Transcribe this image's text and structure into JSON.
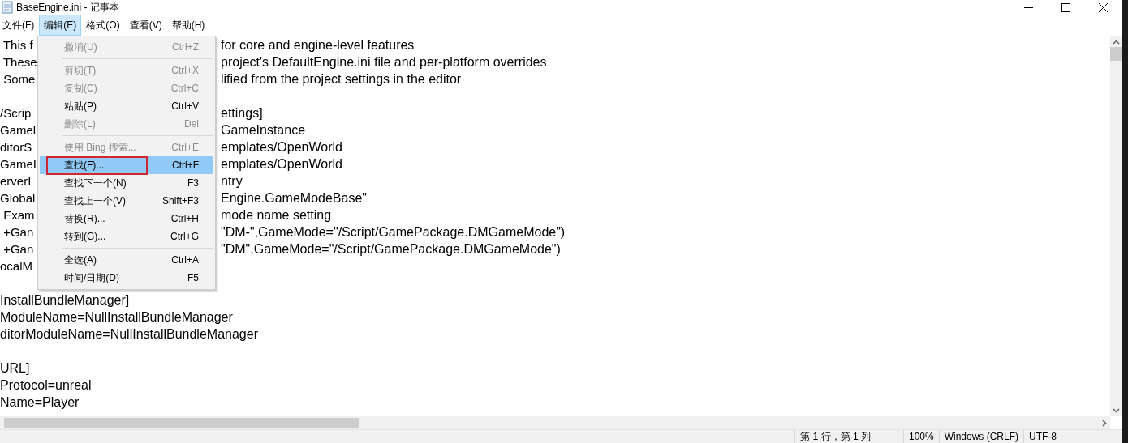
{
  "window": {
    "title": "BaseEngine.ini - 记事本"
  },
  "menubar": [
    {
      "label": "文件(F)",
      "selected": false
    },
    {
      "label": "编辑(E)",
      "selected": true
    },
    {
      "label": "格式(O)",
      "selected": false
    },
    {
      "label": "查看(V)",
      "selected": false
    },
    {
      "label": "帮助(H)",
      "selected": false
    }
  ],
  "editor": {
    "lines": [
      {
        "kind": "split",
        "left": " This f",
        "right": "for core and engine-level features"
      },
      {
        "kind": "split",
        "left": " These",
        "right": "project's DefaultEngine.ini file and per-platform overrides"
      },
      {
        "kind": "split",
        "left": " Some",
        "right": "lified from the project settings in the editor"
      },
      {
        "kind": "blank"
      },
      {
        "kind": "split",
        "left": "/Scrip",
        "right": "ettings]"
      },
      {
        "kind": "split",
        "left": "Gamel",
        "right": "GameInstance"
      },
      {
        "kind": "split",
        "left": "ditorS",
        "right": "emplates/OpenWorld"
      },
      {
        "kind": "split",
        "left": "GameI",
        "right": "emplates/OpenWorld"
      },
      {
        "kind": "split",
        "left": "erverI",
        "right": "ntry"
      },
      {
        "kind": "split",
        "left": "Global",
        "right": "Engine.GameModeBase\""
      },
      {
        "kind": "split",
        "left": " Exam",
        "right": "mode name setting"
      },
      {
        "kind": "split",
        "left": " +Gan",
        "right": "\"DM-\",GameMode=\"/Script/GamePackage.DMGameMode\")"
      },
      {
        "kind": "split",
        "left": " +Gan",
        "right": "\"DM\",GameMode=\"/Script/GamePackage.DMGameMode\")"
      },
      {
        "kind": "split",
        "left": "ocalM"
      },
      {
        "kind": "blank"
      },
      {
        "kind": "full",
        "text": "InstallBundleManager]"
      },
      {
        "kind": "full",
        "text": "ModuleName=NullInstallBundleManager"
      },
      {
        "kind": "full",
        "text": "ditorModuleName=NullInstallBundleManager"
      },
      {
        "kind": "blank"
      },
      {
        "kind": "full",
        "text": "URL]"
      },
      {
        "kind": "full",
        "text": "Protocol=unreal"
      },
      {
        "kind": "full",
        "text": "Name=Player"
      }
    ]
  },
  "edit_menu": [
    {
      "kind": "item",
      "label": "撤消(U)",
      "shortcut": "Ctrl+Z",
      "disabled": true,
      "selected": false
    },
    {
      "kind": "separator"
    },
    {
      "kind": "item",
      "label": "剪切(T)",
      "shortcut": "Ctrl+X",
      "disabled": true,
      "selected": false
    },
    {
      "kind": "item",
      "label": "复制(C)",
      "shortcut": "Ctrl+C",
      "disabled": true,
      "selected": false
    },
    {
      "kind": "item",
      "label": "粘贴(P)",
      "shortcut": "Ctrl+V",
      "disabled": false,
      "selected": false
    },
    {
      "kind": "item",
      "label": "删除(L)",
      "shortcut": "Del",
      "disabled": true,
      "selected": false
    },
    {
      "kind": "separator"
    },
    {
      "kind": "item",
      "label": "使用 Bing 搜索...",
      "shortcut": "Ctrl+E",
      "disabled": true,
      "selected": false
    },
    {
      "kind": "item",
      "label": "查找(F)...",
      "shortcut": "Ctrl+F",
      "disabled": false,
      "selected": true,
      "outlined": true
    },
    {
      "kind": "item",
      "label": "查找下一个(N)",
      "shortcut": "F3",
      "disabled": false,
      "selected": false
    },
    {
      "kind": "item",
      "label": "查找上一个(V)",
      "shortcut": "Shift+F3",
      "disabled": false,
      "selected": false
    },
    {
      "kind": "item",
      "label": "替换(R)...",
      "shortcut": "Ctrl+H",
      "disabled": false,
      "selected": false
    },
    {
      "kind": "item",
      "label": "转到(G)...",
      "shortcut": "Ctrl+G",
      "disabled": false,
      "selected": false
    },
    {
      "kind": "separator"
    },
    {
      "kind": "item",
      "label": "全选(A)",
      "shortcut": "Ctrl+A",
      "disabled": false,
      "selected": false
    },
    {
      "kind": "item",
      "label": "时间/日期(D)",
      "shortcut": "F5",
      "disabled": false,
      "selected": false
    }
  ],
  "status_bar": [
    "第 1 行，第 1 列",
    "100%",
    "Windows (CRLF)",
    "UTF-8"
  ]
}
